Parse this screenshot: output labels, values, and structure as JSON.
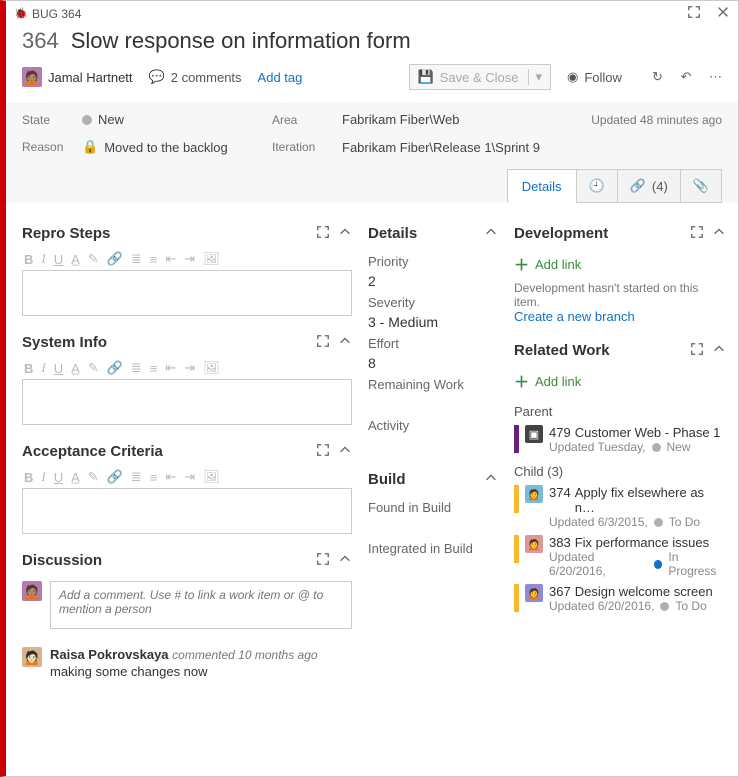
{
  "window": {
    "type_label": "BUG",
    "id": "364",
    "title": "Slow response on information form"
  },
  "header": {
    "assignee": "Jamal Hartnett",
    "comments_label": "2 comments",
    "add_tag_label": "Add tag",
    "save_label": "Save & Close",
    "follow_label": "Follow"
  },
  "fields": {
    "state_label": "State",
    "state_value": "New",
    "reason_label": "Reason",
    "reason_value": "Moved to the backlog",
    "area_label": "Area",
    "area_value": "Fabrikam Fiber\\Web",
    "iteration_label": "Iteration",
    "iteration_value": "Fabrikam Fiber\\Release 1\\Sprint 9",
    "updated_text": "Updated 48 minutes ago"
  },
  "tabs": {
    "details": "Details",
    "links_count": "(4)"
  },
  "left": {
    "repro_heading": "Repro Steps",
    "sysinfo_heading": "System Info",
    "accept_heading": "Acceptance Criteria",
    "discussion_heading": "Discussion",
    "discussion_placeholder": "Add a comment. Use # to link a work item or @ to mention a person",
    "comment_author": "Raisa Pokrovskaya",
    "comment_meta": "commented 10 months ago",
    "comment_body": "making some changes now"
  },
  "mid": {
    "details_heading": "Details",
    "priority_label": "Priority",
    "priority_value": "2",
    "severity_label": "Severity",
    "severity_value": "3 - Medium",
    "effort_label": "Effort",
    "effort_value": "8",
    "remaining_label": "Remaining Work",
    "activity_label": "Activity",
    "build_heading": "Build",
    "found_label": "Found in Build",
    "integrated_label": "Integrated in Build"
  },
  "right": {
    "dev_heading": "Development",
    "add_link_label": "Add link",
    "dev_empty_text": "Development hasn't started on this item.",
    "create_branch_label": "Create a new branch",
    "related_heading": "Related Work",
    "parent_label": "Parent",
    "child_label": "Child (3)",
    "items": {
      "parent": {
        "id": "479",
        "title": "Customer Web - Phase 1",
        "meta": "Updated Tuesday,",
        "state": "New"
      },
      "child1": {
        "id": "374",
        "title": "Apply fix elsewhere as n…",
        "meta": "Updated 6/3/2015,",
        "state": "To Do"
      },
      "child2": {
        "id": "383",
        "title": "Fix performance issues",
        "meta": "Updated 6/20/2016,",
        "state": "In Progress"
      },
      "child3": {
        "id": "367",
        "title": "Design welcome screen",
        "meta": "Updated 6/20/2016,",
        "state": "To Do"
      }
    }
  }
}
